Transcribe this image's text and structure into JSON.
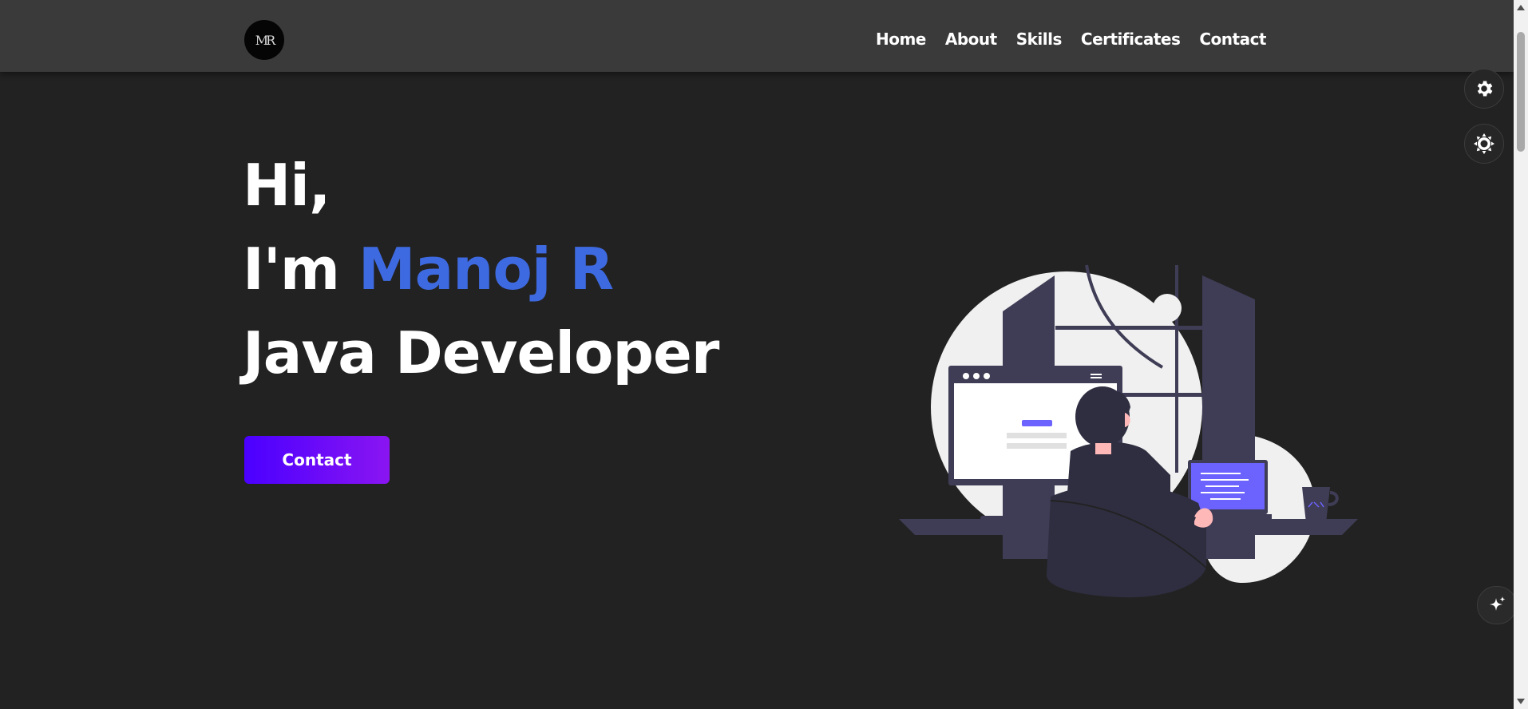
{
  "nav": {
    "logo_text": "MR",
    "links": [
      "Home",
      "About",
      "Skills",
      "Certificates",
      "Contact"
    ]
  },
  "hero": {
    "greeting": "Hi,",
    "intro": "I'm ",
    "name": "Manoj R",
    "role": "Java Developer",
    "cta_label": "Contact"
  },
  "icons": {
    "settings": "gear-icon",
    "theme": "sun-icon",
    "ai": "sparkle-icon"
  },
  "colors": {
    "background": "#222222",
    "navbar": "#3a3a3a",
    "accent": "#3e6ae1",
    "button_start": "#4a00ff",
    "button_end": "#8a15f2"
  }
}
